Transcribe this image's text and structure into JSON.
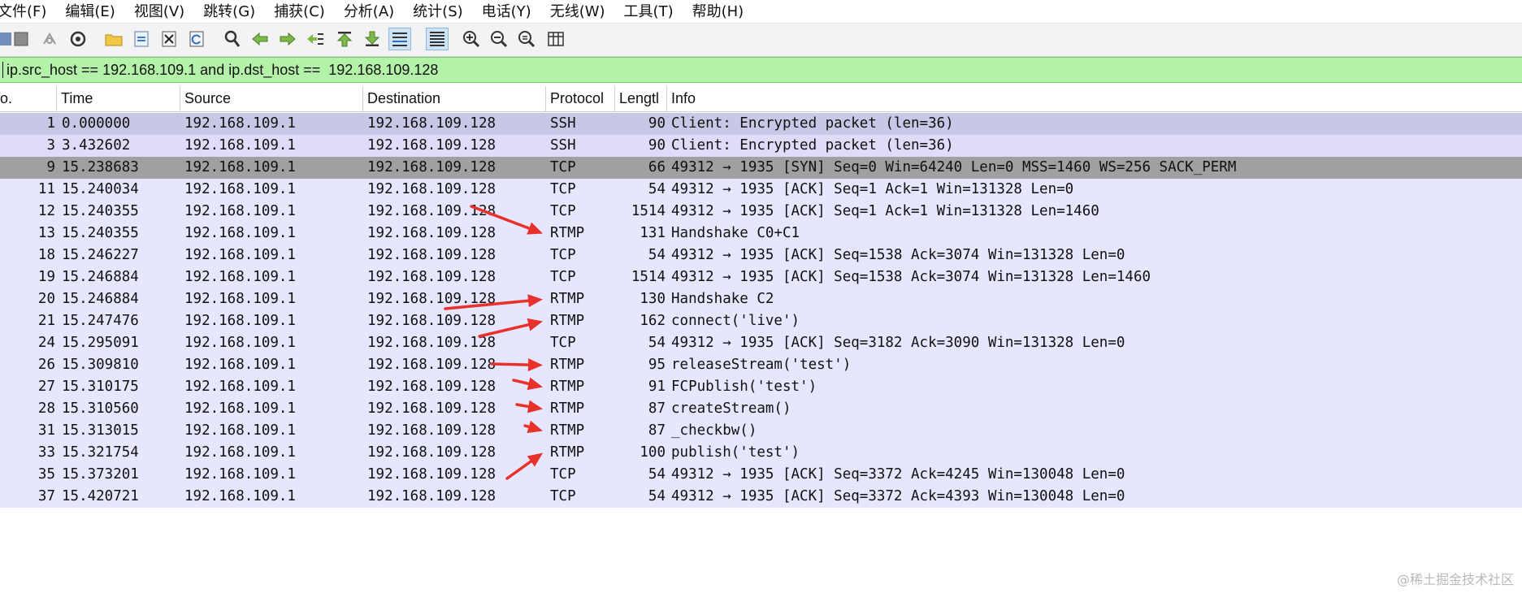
{
  "menu": [
    "文件(F)",
    "编辑(E)",
    "视图(V)",
    "跳转(G)",
    "捕获(C)",
    "分析(A)",
    "统计(S)",
    "电话(Y)",
    "无线(W)",
    "工具(T)",
    "帮助(H)"
  ],
  "toolbar": {
    "buttons": [
      "stop-capture-icon",
      "restart-capture-icon",
      "capture-options-icon",
      "open-file-icon",
      "save-file-icon",
      "close-file-icon",
      "reload-file-icon",
      "find-packet-icon",
      "go-back-icon",
      "go-forward-icon",
      "go-to-packet-icon",
      "go-first-icon",
      "go-last-icon",
      "auto-scroll-icon",
      "colorize-icon",
      "zoom-in-icon",
      "zoom-out-icon",
      "zoom-normal-icon",
      "resize-columns-icon"
    ]
  },
  "filter": {
    "value": "ip.src_host == 192.168.109.1 and ip.dst_host ==  192.168.109.128",
    "bg_color": "#b5f2a9"
  },
  "columns": [
    "o.",
    "Time",
    "Source",
    "Destination",
    "Protocol",
    "Lengtl",
    "Info"
  ],
  "colors": {
    "tcp_row": "#e7e6ff",
    "ssh_row_1": "#c9c7e6",
    "ssh_row_2": "#dedcf8",
    "syn_row": "#a0a0a0",
    "arrow": "#e8312a"
  },
  "packets": [
    {
      "no": "1",
      "time": "0.000000",
      "src": "192.168.109.1",
      "dst": "192.168.109.128",
      "proto": "SSH",
      "len": "90",
      "info": "Client: Encrypted packet (len=36)",
      "style": "ssh1"
    },
    {
      "no": "3",
      "time": "3.432602",
      "src": "192.168.109.1",
      "dst": "192.168.109.128",
      "proto": "SSH",
      "len": "90",
      "info": "Client: Encrypted packet (len=36)",
      "style": "ssh2"
    },
    {
      "no": "9",
      "time": "15.238683",
      "src": "192.168.109.1",
      "dst": "192.168.109.128",
      "proto": "TCP",
      "len": "66",
      "info": "49312 → 1935 [SYN] Seq=0 Win=64240 Len=0 MSS=1460 WS=256 SACK_PERM",
      "style": "syn"
    },
    {
      "no": "11",
      "time": "15.240034",
      "src": "192.168.109.1",
      "dst": "192.168.109.128",
      "proto": "TCP",
      "len": "54",
      "info": "49312 → 1935 [ACK] Seq=1 Ack=1 Win=131328 Len=0",
      "style": "tcp"
    },
    {
      "no": "12",
      "time": "15.240355",
      "src": "192.168.109.1",
      "dst": "192.168.109.128",
      "proto": "TCP",
      "len": "1514",
      "info": "49312 → 1935 [ACK] Seq=1 Ack=1 Win=131328 Len=1460",
      "style": "tcp"
    },
    {
      "no": "13",
      "time": "15.240355",
      "src": "192.168.109.1",
      "dst": "192.168.109.128",
      "proto": "RTMP",
      "len": "131",
      "info": "Handshake C0+C1",
      "style": "tcp"
    },
    {
      "no": "18",
      "time": "15.246227",
      "src": "192.168.109.1",
      "dst": "192.168.109.128",
      "proto": "TCP",
      "len": "54",
      "info": "49312 → 1935 [ACK] Seq=1538 Ack=3074 Win=131328 Len=0",
      "style": "tcp"
    },
    {
      "no": "19",
      "time": "15.246884",
      "src": "192.168.109.1",
      "dst": "192.168.109.128",
      "proto": "TCP",
      "len": "1514",
      "info": "49312 → 1935 [ACK] Seq=1538 Ack=3074 Win=131328 Len=1460",
      "style": "tcp"
    },
    {
      "no": "20",
      "time": "15.246884",
      "src": "192.168.109.1",
      "dst": "192.168.109.128",
      "proto": "RTMP",
      "len": "130",
      "info": "Handshake C2",
      "style": "tcp"
    },
    {
      "no": "21",
      "time": "15.247476",
      "src": "192.168.109.1",
      "dst": "192.168.109.128",
      "proto": "RTMP",
      "len": "162",
      "info": "connect('live')",
      "style": "tcp"
    },
    {
      "no": "24",
      "time": "15.295091",
      "src": "192.168.109.1",
      "dst": "192.168.109.128",
      "proto": "TCP",
      "len": "54",
      "info": "49312 → 1935 [ACK] Seq=3182 Ack=3090 Win=131328 Len=0",
      "style": "tcp"
    },
    {
      "no": "26",
      "time": "15.309810",
      "src": "192.168.109.1",
      "dst": "192.168.109.128",
      "proto": "RTMP",
      "len": "95",
      "info": "releaseStream('test')",
      "style": "tcp"
    },
    {
      "no": "27",
      "time": "15.310175",
      "src": "192.168.109.1",
      "dst": "192.168.109.128",
      "proto": "RTMP",
      "len": "91",
      "info": "FCPublish('test')",
      "style": "tcp"
    },
    {
      "no": "28",
      "time": "15.310560",
      "src": "192.168.109.1",
      "dst": "192.168.109.128",
      "proto": "RTMP",
      "len": "87",
      "info": "createStream()",
      "style": "tcp"
    },
    {
      "no": "31",
      "time": "15.313015",
      "src": "192.168.109.1",
      "dst": "192.168.109.128",
      "proto": "RTMP",
      "len": "87",
      "info": "_checkbw()",
      "style": "tcp"
    },
    {
      "no": "33",
      "time": "15.321754",
      "src": "192.168.109.1",
      "dst": "192.168.109.128",
      "proto": "RTMP",
      "len": "100",
      "info": "publish('test')",
      "style": "tcp"
    },
    {
      "no": "35",
      "time": "15.373201",
      "src": "192.168.109.1",
      "dst": "192.168.109.128",
      "proto": "TCP",
      "len": "54",
      "info": "49312 → 1935 [ACK] Seq=3372 Ack=4245 Win=130048 Len=0",
      "style": "tcp"
    },
    {
      "no": "37",
      "time": "15.420721",
      "src": "192.168.109.1",
      "dst": "192.168.109.128",
      "proto": "TCP",
      "len": "54",
      "info": "49312 → 1935 [ACK] Seq=3372 Ack=4393 Win=130048 Len=0",
      "style": "tcp"
    }
  ],
  "annotations": {
    "arrow_target_rows": [
      "13",
      "20",
      "21",
      "26",
      "27",
      "28",
      "31",
      "33"
    ]
  },
  "watermark": "@稀土掘金技术社区"
}
